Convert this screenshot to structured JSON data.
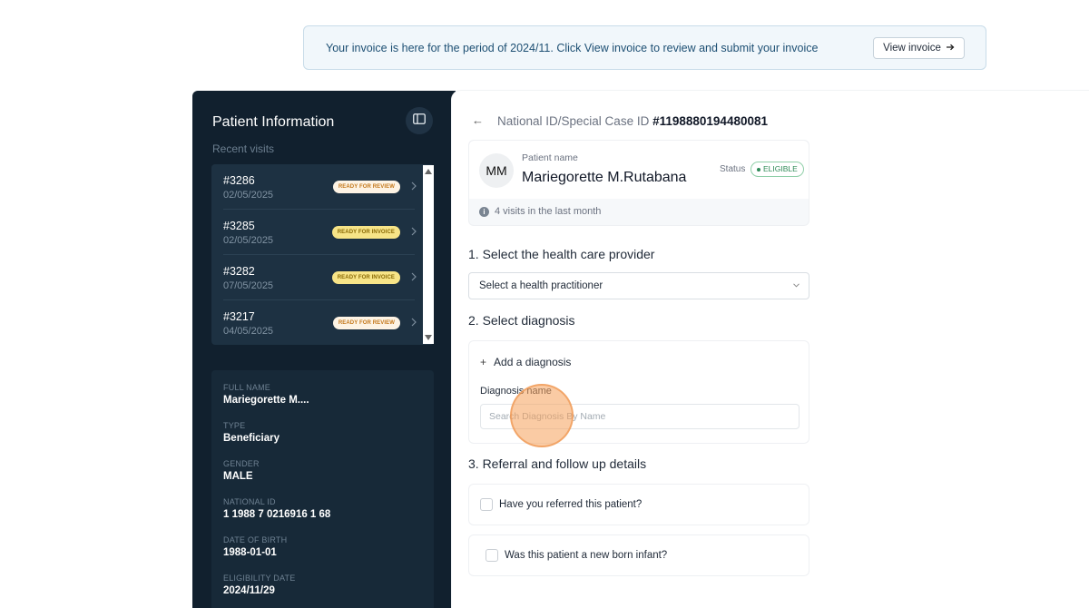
{
  "banner": {
    "text": "Your invoice is here for the period of 2024/11. Click View invoice to review and submit your invoice",
    "button_label": "View invoice"
  },
  "sidebar": {
    "title": "Patient Information",
    "recent_label": "Recent visits",
    "visits": [
      {
        "id": "#3286",
        "date": "02/05/2025",
        "status": "READY FOR REVIEW"
      },
      {
        "id": "#3285",
        "date": "02/05/2025",
        "status": "READY FOR INVOICE"
      },
      {
        "id": "#3282",
        "date": "07/05/2025",
        "status": "READY FOR INVOICE"
      },
      {
        "id": "#3217",
        "date": "04/05/2025",
        "status": "READY FOR REVIEW"
      }
    ],
    "details": [
      {
        "label": "FULL NAME",
        "value": "Mariegorette M...."
      },
      {
        "label": "TYPE",
        "value": "Beneficiary"
      },
      {
        "label": "GENDER",
        "value": "MALE"
      },
      {
        "label": "NATIONAL ID",
        "value": "1 1988 7 0216916 1 68"
      },
      {
        "label": "DATE OF BIRTH",
        "value": "1988-01-01"
      },
      {
        "label": "ELIGIBILITY DATE",
        "value": "2024/11/29"
      }
    ]
  },
  "main": {
    "back_arrow": "←",
    "nid_label": "National ID/Special Case ID",
    "nid_value": "#1198880194480081",
    "patient": {
      "initials": "MM",
      "name_label": "Patient name",
      "name": "Mariegorette M.Rutabana",
      "status_label": "Status",
      "status_value": "ELIGIBLE",
      "visits_info": "4 visits in the last month"
    },
    "section1_title": "1. Select the health care provider",
    "provider_select_value": "Select a health practitioner",
    "section2_title": "2. Select diagnosis",
    "add_diagnosis_label": "Add a diagnosis",
    "diagnosis_name_label": "Diagnosis name",
    "diagnosis_placeholder": "Search Diagnosis By Name",
    "section3_title": "3. Referral and follow up details",
    "referral_question": "Have you referred this patient?",
    "newborn_question": "Was this patient a new born infant?"
  },
  "colors": {
    "sidebar_bg": "#11202e",
    "eligible_green": "#2e8a56",
    "review_badge": "#fdf3e4",
    "invoice_badge": "#f7e487",
    "banner_bg": "#f1f7fb"
  }
}
